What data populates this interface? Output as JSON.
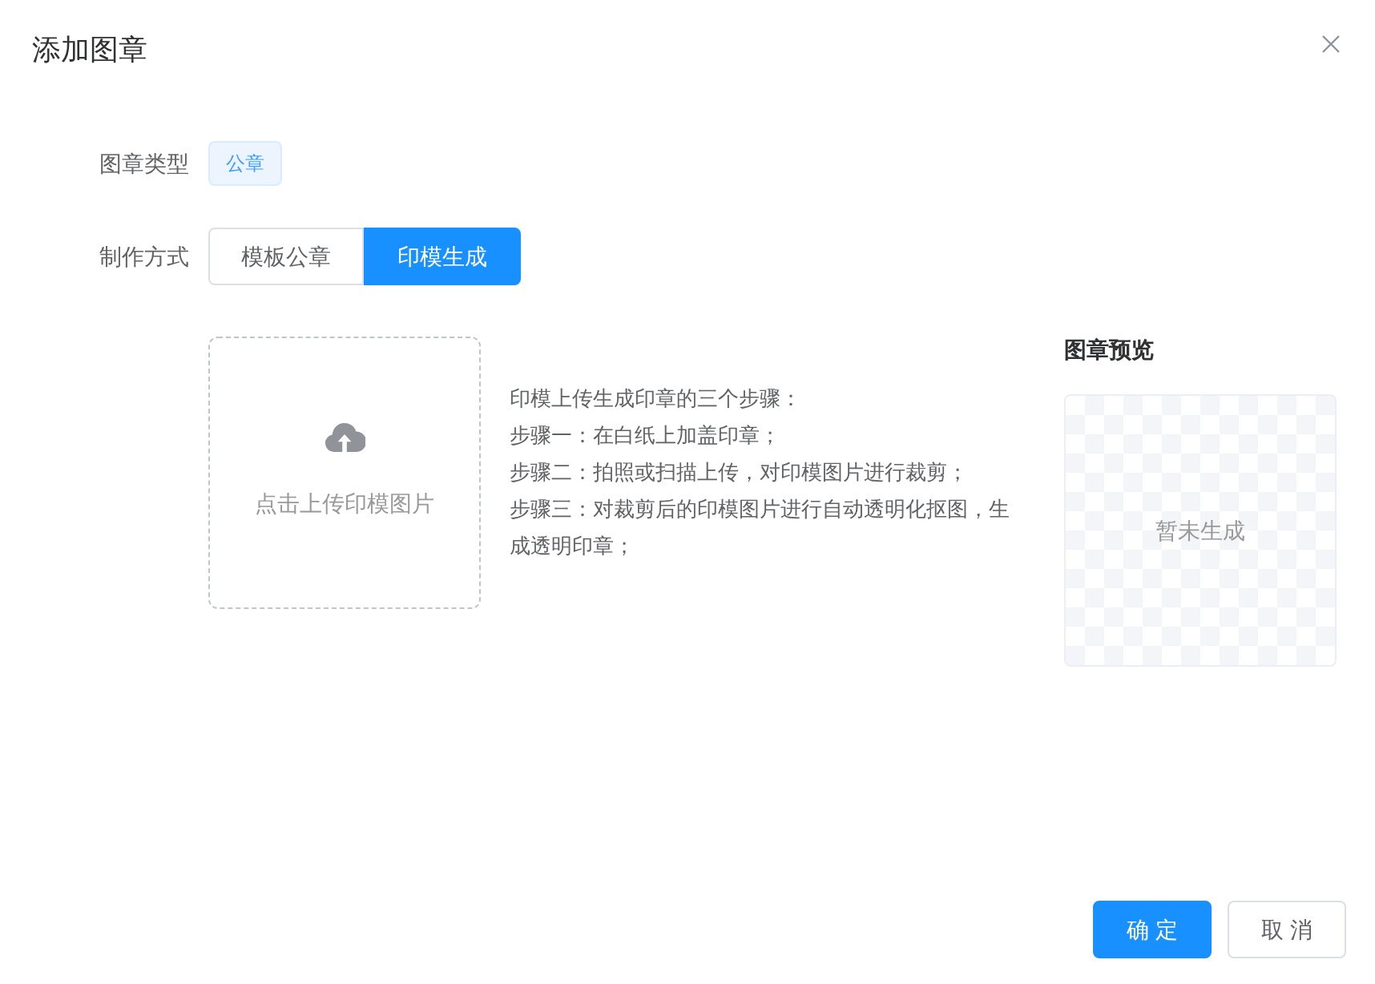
{
  "dialog": {
    "title": "添加图章"
  },
  "form": {
    "seal_type": {
      "label": "图章类型",
      "tag": "公章"
    },
    "method": {
      "label": "制作方式",
      "options": [
        {
          "label": "模板公章",
          "selected": false
        },
        {
          "label": "印模生成",
          "selected": true
        }
      ]
    }
  },
  "upload": {
    "text": "点击上传印模图片"
  },
  "instructions": [
    "印模上传生成印章的三个步骤：",
    "步骤一：在白纸上加盖印章；",
    "步骤二：拍照或扫描上传，对印模图片进行裁剪；",
    "步骤三：对裁剪后的印模图片进行自动透明化抠图，生成透明印章；"
  ],
  "preview": {
    "title": "图章预览",
    "empty_text": "暂未生成"
  },
  "footer": {
    "buttons": [
      {
        "label": "确 定",
        "kind": "primary"
      },
      {
        "label": "取 消",
        "kind": "default"
      }
    ]
  }
}
